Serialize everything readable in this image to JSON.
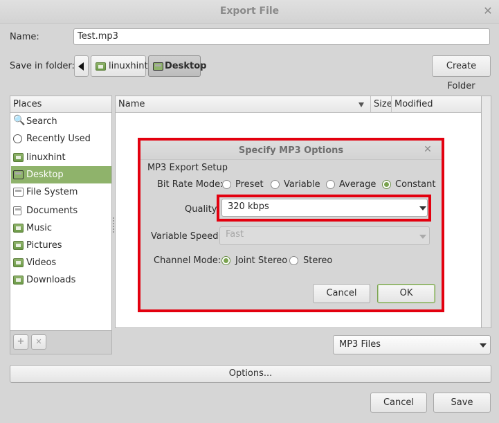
{
  "window": {
    "title": "Export File"
  },
  "name_row": {
    "label": "Name:",
    "value": "Test.mp3"
  },
  "folder_row": {
    "label": "Save in folder:",
    "crumbs": [
      "linuxhint",
      "Desktop"
    ],
    "create_folder": "Create Folder"
  },
  "places": {
    "header": "Places",
    "items": [
      {
        "label": "Search",
        "icon": "search-icon"
      },
      {
        "label": "Recently Used",
        "icon": "clock-icon"
      },
      {
        "label": "linuxhint",
        "icon": "home-folder-icon"
      },
      {
        "label": "Desktop",
        "icon": "desktop-icon"
      },
      {
        "label": "File System",
        "icon": "drive-icon"
      },
      {
        "label": "Documents",
        "icon": "folder-icon"
      },
      {
        "label": "Music",
        "icon": "music-folder-icon"
      },
      {
        "label": "Pictures",
        "icon": "pictures-folder-icon"
      },
      {
        "label": "Videos",
        "icon": "videos-folder-icon"
      },
      {
        "label": "Downloads",
        "icon": "downloads-folder-icon"
      }
    ],
    "selected": "Desktop",
    "add_glyph": "+",
    "remove_glyph": "✕"
  },
  "files": {
    "col_name": "Name",
    "col_size": "Size",
    "col_modified": "Modified"
  },
  "filter": "MP3 Files",
  "options_button": "Options...",
  "footer": {
    "cancel": "Cancel",
    "save": "Save"
  },
  "mp3_dialog": {
    "title": "Specify MP3 Options",
    "section": "MP3 Export Setup",
    "bitrate_label": "Bit Rate Mode:",
    "bitrate_options": [
      "Preset",
      "Variable",
      "Average",
      "Constant"
    ],
    "bitrate_selected": "Constant",
    "quality_label": "Quality",
    "quality_value": "320 kbps",
    "speed_label": "Variable Speed:",
    "speed_value": "Fast",
    "channel_label": "Channel Mode:",
    "channel_options": [
      "Joint Stereo",
      "Stereo"
    ],
    "channel_selected": "Joint Stereo",
    "cancel": "Cancel",
    "ok": "OK"
  },
  "colors": {
    "accent": "#8fb36b",
    "highlight": "#e3000f"
  }
}
